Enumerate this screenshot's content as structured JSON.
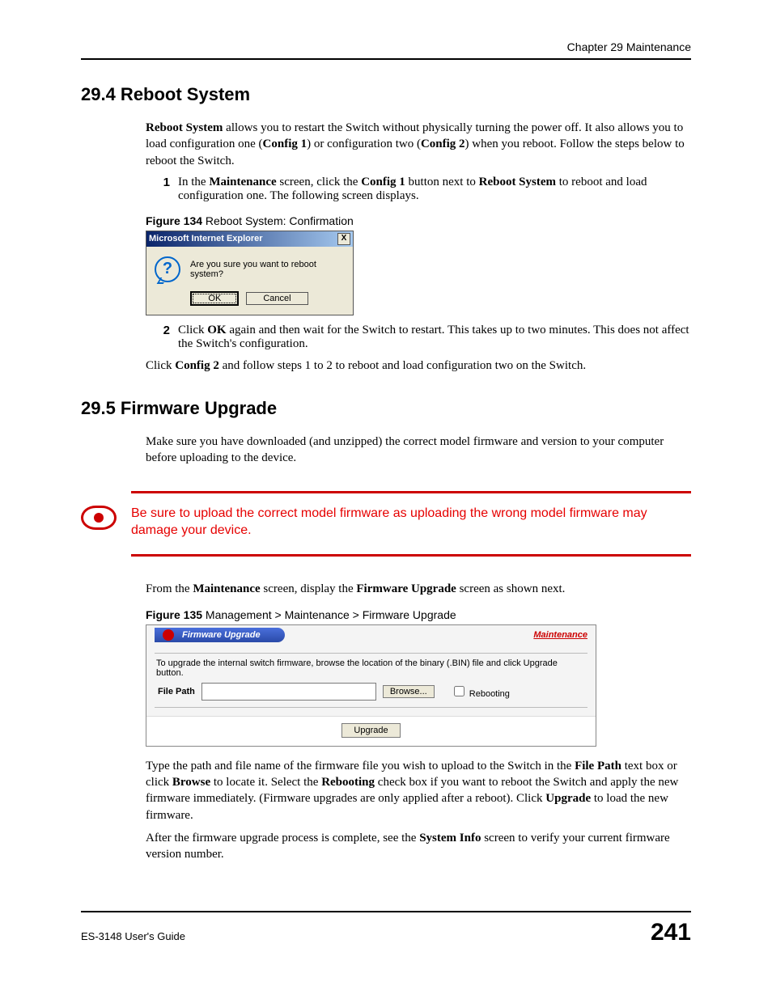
{
  "header": {
    "chapter": "Chapter 29 Maintenance"
  },
  "sec294": {
    "heading": "29.4  Reboot System",
    "intro_pre": "Reboot System",
    "intro_mid1": " allows you to restart the Switch without physically turning the power off. It also allows you to load configuration one (",
    "cfg1": "Config 1",
    "intro_mid2": ") or configuration two (",
    "cfg2": "Config 2",
    "intro_post": ") when you reboot. Follow the steps below to reboot the Switch.",
    "step1_num": "1",
    "step1_a": "In the ",
    "step1_b": "Maintenance",
    "step1_c": " screen, click the ",
    "step1_d": "Config 1",
    "step1_e": " button next to ",
    "step1_f": "Reboot System",
    "step1_g": " to reboot and load configuration one. The following screen displays.",
    "fig134_num": "Figure 134",
    "fig134_title": "   Reboot System: Confirmation",
    "dialog_title": "Microsoft Internet Explorer",
    "dialog_close": "X",
    "dialog_q": "?",
    "dialog_msg": "Are you sure you want to reboot system?",
    "dialog_ok": "OK",
    "dialog_cancel": "Cancel",
    "step2_num": "2",
    "step2_a": "Click ",
    "step2_b": "OK",
    "step2_c": " again and then wait for the Switch to restart. This takes up to two minutes. This does not affect the Switch's configuration.",
    "tail_a": "Click ",
    "tail_b": "Config 2",
    "tail_c": " and follow steps 1 to 2 to reboot and load configuration two on the Switch."
  },
  "sec295": {
    "heading": "29.5  Firmware Upgrade",
    "intro": "Make sure you have downloaded (and unzipped) the correct model firmware and version to your computer before uploading to the device.",
    "warning": "Be sure to upload the correct model firmware as uploading the wrong model firmware may damage your device.",
    "from_a": "From the ",
    "from_b": "Maintenance",
    "from_c": " screen, display the ",
    "from_d": "Firmware Upgrade",
    "from_e": " screen as shown next.",
    "fig135_num": "Figure 135",
    "fig135_title": "   Management > Maintenance > Firmware Upgrade",
    "fw_tab": "Firmware Upgrade",
    "fw_link": "Maintenance",
    "fw_instr": "To upgrade the internal switch firmware, browse the location of the binary (.BIN) file and click Upgrade button.",
    "fw_label": "File Path",
    "fw_browse": "Browse...",
    "fw_reboot": "Rebooting",
    "fw_upgrade": "Upgrade",
    "p2_a": "Type the path and file name of the firmware file you wish to upload to the Switch in the ",
    "p2_b": "File Path",
    "p2_c": " text box or click ",
    "p2_d": "Browse",
    "p2_e": " to locate it. Select the ",
    "p2_f": "Rebooting",
    "p2_g": " check box if you want to reboot the Switch and apply the new firmware immediately. (Firmware upgrades are only applied after a reboot). Click ",
    "p2_h": "Upgrade",
    "p2_i": " to load the new firmware.",
    "p3_a": "After the firmware upgrade process is complete, see the ",
    "p3_b": "System Info",
    "p3_c": " screen to verify your current firmware version number."
  },
  "footer": {
    "guide": "ES-3148 User's Guide",
    "page": "241"
  }
}
